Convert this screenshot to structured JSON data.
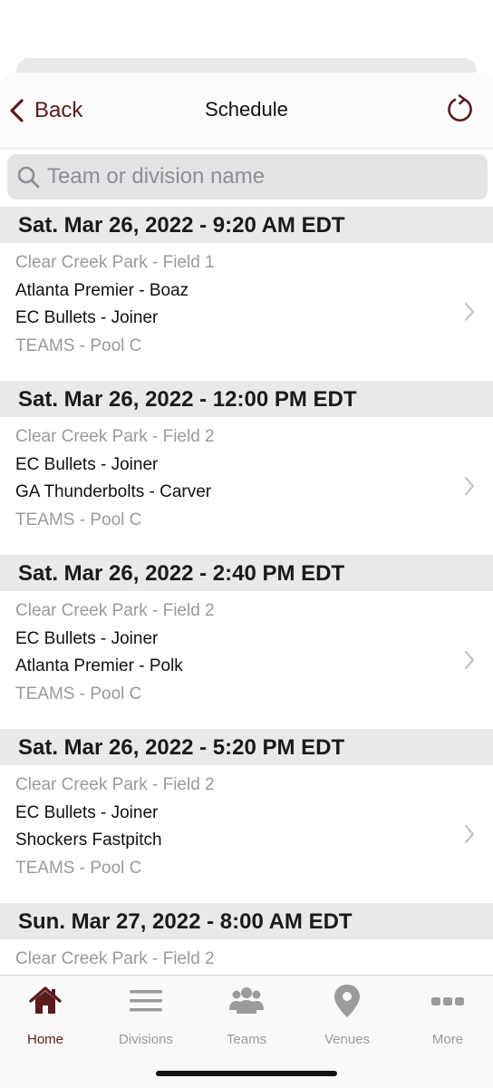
{
  "header": {
    "back_label": "Back",
    "title": "Schedule"
  },
  "search": {
    "placeholder": "Team or division name",
    "value": ""
  },
  "sections": [
    {
      "header": "Sat. Mar 26, 2022 - 9:20 AM EDT",
      "game": {
        "venue": "Clear Creek Park - Field 1",
        "team1": "Atlanta Premier - Boaz",
        "team2": "EC Bullets - Joiner",
        "division": "TEAMS - Pool C"
      }
    },
    {
      "header": "Sat. Mar 26, 2022 - 12:00 PM EDT",
      "game": {
        "venue": "Clear Creek Park - Field 2",
        "team1": "EC Bullets - Joiner",
        "team2": "GA Thunderbolts - Carver",
        "division": "TEAMS - Pool C"
      }
    },
    {
      "header": "Sat. Mar 26, 2022 - 2:40 PM EDT",
      "game": {
        "venue": "Clear Creek Park - Field 2",
        "team1": "EC Bullets - Joiner",
        "team2": "Atlanta Premier - Polk",
        "division": "TEAMS - Pool C"
      }
    },
    {
      "header": "Sat. Mar 26, 2022 - 5:20 PM EDT",
      "game": {
        "venue": "Clear Creek Park - Field 2",
        "team1": "EC Bullets - Joiner",
        "team2": "Shockers Fastpitch",
        "division": "TEAMS - Pool C"
      }
    },
    {
      "header": "Sun. Mar 27, 2022 - 8:00 AM EDT",
      "game": {
        "venue": "Clear Creek Park - Field 2",
        "team1": "",
        "team2": "",
        "division": ""
      }
    }
  ],
  "tabbar": {
    "tabs": [
      {
        "label": "Home",
        "icon": "home-icon",
        "active": true
      },
      {
        "label": "Divisions",
        "icon": "list-icon",
        "active": false
      },
      {
        "label": "Teams",
        "icon": "people-icon",
        "active": false
      },
      {
        "label": "Venues",
        "icon": "map-pin-icon",
        "active": false
      },
      {
        "label": "More",
        "icon": "more-icon",
        "active": false
      }
    ]
  },
  "colors": {
    "accent": "#5a1c1c",
    "inactive": "#9b9b9b",
    "section_bg": "#e9e9ea"
  }
}
